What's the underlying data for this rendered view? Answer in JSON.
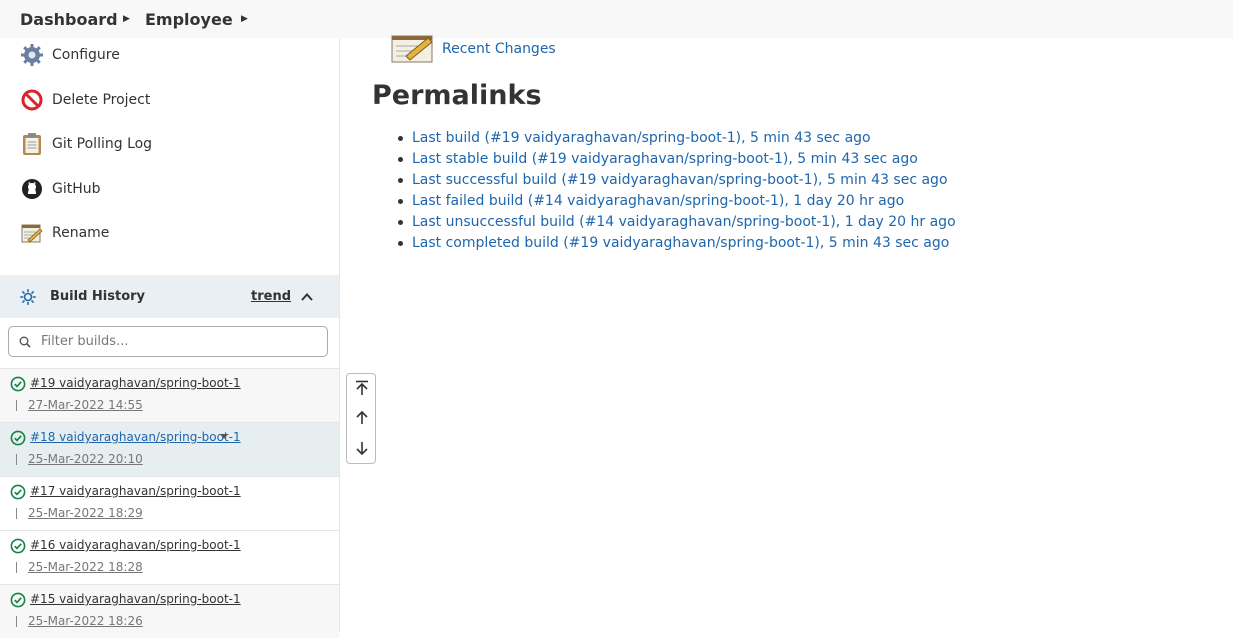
{
  "breadcrumb": {
    "items": [
      {
        "label": "Dashboard"
      },
      {
        "label": "Employee"
      }
    ]
  },
  "sidebar": {
    "tasks": [
      {
        "label": "Configure",
        "icon": "gear-icon"
      },
      {
        "label": "Delete Project",
        "icon": "no-entry-icon"
      },
      {
        "label": "Git Polling Log",
        "icon": "clipboard-icon"
      },
      {
        "label": "GitHub",
        "icon": "github-icon"
      },
      {
        "label": "Rename",
        "icon": "notepad-pencil-icon"
      }
    ],
    "build_history": {
      "title": "Build History",
      "trend": "trend",
      "filter_placeholder": "Filter builds...",
      "builds": [
        {
          "name": "#19 vaidyaraghavan/spring-boot-1",
          "date": "27-Mar-2022 14:55",
          "status": "success"
        },
        {
          "name": "#18 vaidyaraghavan/spring-boot-1",
          "date": "25-Mar-2022 20:10",
          "status": "success"
        },
        {
          "name": "#17 vaidyaraghavan/spring-boot-1",
          "date": "25-Mar-2022 18:29",
          "status": "success"
        },
        {
          "name": "#16 vaidyaraghavan/spring-boot-1",
          "date": "25-Mar-2022 18:28",
          "status": "success"
        },
        {
          "name": "#15 vaidyaraghavan/spring-boot-1",
          "date": "25-Mar-2022 18:26",
          "status": "success"
        }
      ]
    }
  },
  "main": {
    "recent_changes": "Recent Changes",
    "permalinks_title": "Permalinks",
    "permalinks": [
      "Last build (#19 vaidyaraghavan/spring-boot-1), 5 min 43 sec ago",
      "Last stable build (#19 vaidyaraghavan/spring-boot-1), 5 min 43 sec ago",
      "Last successful build (#19 vaidyaraghavan/spring-boot-1), 5 min 43 sec ago",
      "Last failed build (#14 vaidyaraghavan/spring-boot-1), 1 day 20 hr ago",
      "Last unsuccessful build (#14 vaidyaraghavan/spring-boot-1), 1 day 20 hr ago",
      "Last completed build (#19 vaidyaraghavan/spring-boot-1), 5 min 43 sec ago"
    ]
  },
  "colors": {
    "link": "#1e66ad",
    "success": "#138347",
    "sidebar_header_bg": "#e9eff2"
  }
}
